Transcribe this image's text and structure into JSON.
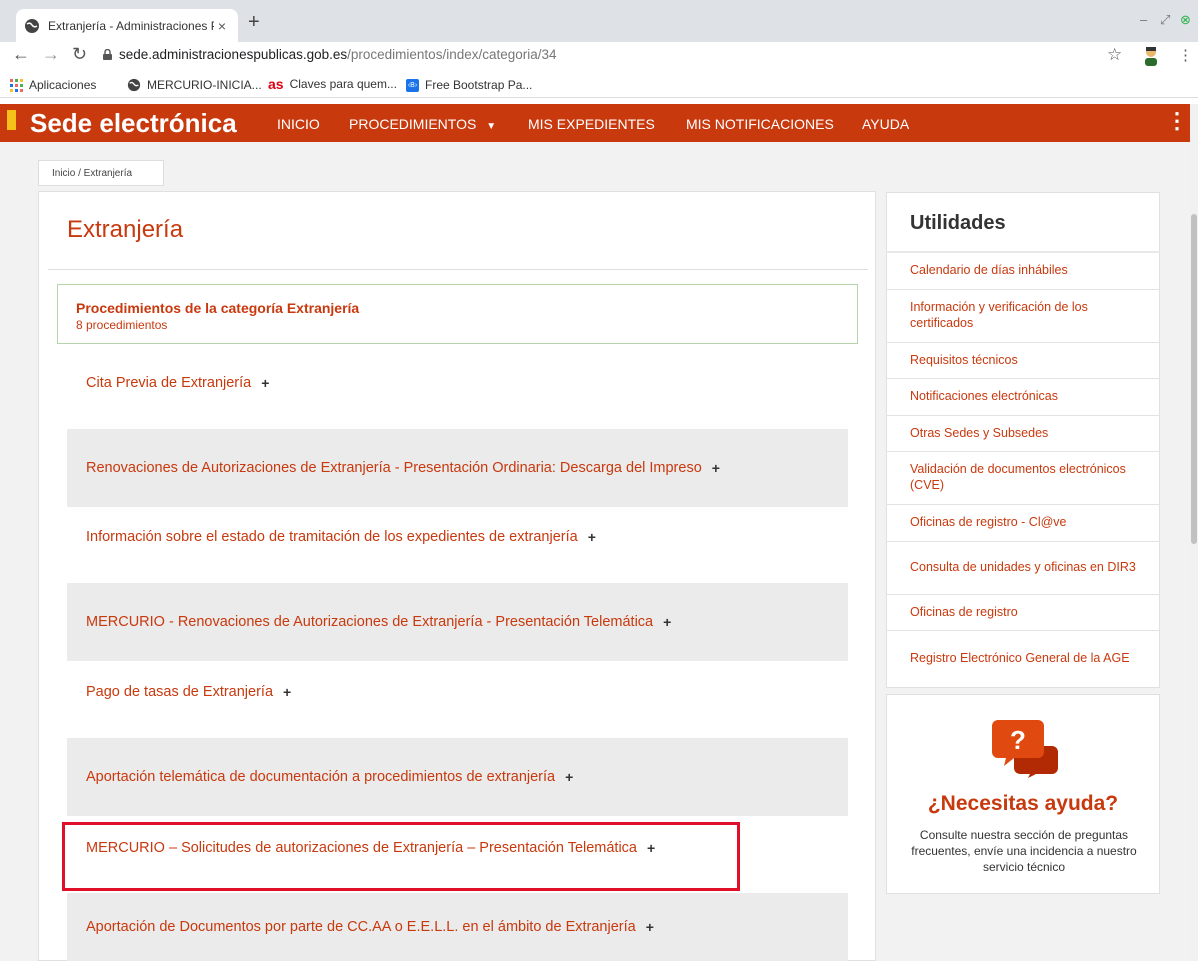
{
  "browser": {
    "tab_title": "Extranjería - Administraciones P",
    "url_host": "sede.administracionespublicas.gob.es",
    "url_path": "/procedimientos/index/categoria/34",
    "bookmarks": [
      {
        "label": "Aplicaciones",
        "icon": "apps-grid-icon"
      },
      {
        "label": "MERCURIO-INICIA...",
        "icon": "globe-icon"
      },
      {
        "label": "Claves para quem...",
        "icon": "as-logo-icon"
      },
      {
        "label": "Free Bootstrap Pa...",
        "icon": "bootstrap-icon"
      }
    ]
  },
  "site": {
    "brand": "Sede electrónica",
    "nav": [
      "INICIO",
      "PROCEDIMIENTOS",
      "MIS EXPEDIENTES",
      "MIS NOTIFICACIONES",
      "AYUDA"
    ],
    "accent_color": "#c8390e"
  },
  "breadcrumb": "Inicio / Extranjería",
  "main": {
    "title": "Extranjería",
    "category_title": "Procedimientos de la categoría Extranjería",
    "category_count": "8 procedimientos",
    "procedures": [
      "Cita Previa de Extranjería",
      "Renovaciones de Autorizaciones de Extranjería - Presentación Ordinaria: Descarga del Impreso",
      "Información sobre el estado de tramitación de los expedientes de extranjería",
      "MERCURIO - Renovaciones de Autorizaciones de Extranjería - Presentación Telemática",
      "Pago de tasas de Extranjería",
      "Aportación telemática de documentación a procedimientos de extranjería",
      "MERCURIO – Solicitudes de autorizaciones de Extranjería – Presentación Telemática",
      "Aportación de Documentos por parte de CC.AA o E.E.L.L. en el ámbito de Extranjería"
    ],
    "plus": "+"
  },
  "sidebar": {
    "title": "Utilidades",
    "links": [
      "Calendario de días inhábiles",
      "Información y verificación de los certificados",
      "Requisitos técnicos",
      "Notificaciones electrónicas",
      "Otras Sedes y Subsedes",
      "Validación de documentos electrónicos (CVE)",
      "Oficinas de registro - Cl@ve",
      "Consulta de unidades y oficinas en DIR3",
      "Oficinas de registro",
      "Registro Electrónico General de la AGE"
    ],
    "help_title": "¿Necesitas ayuda?",
    "help_text": "Consulte nuestra sección de preguntas frecuentes, envíe una incidencia a nuestro servicio técnico"
  }
}
